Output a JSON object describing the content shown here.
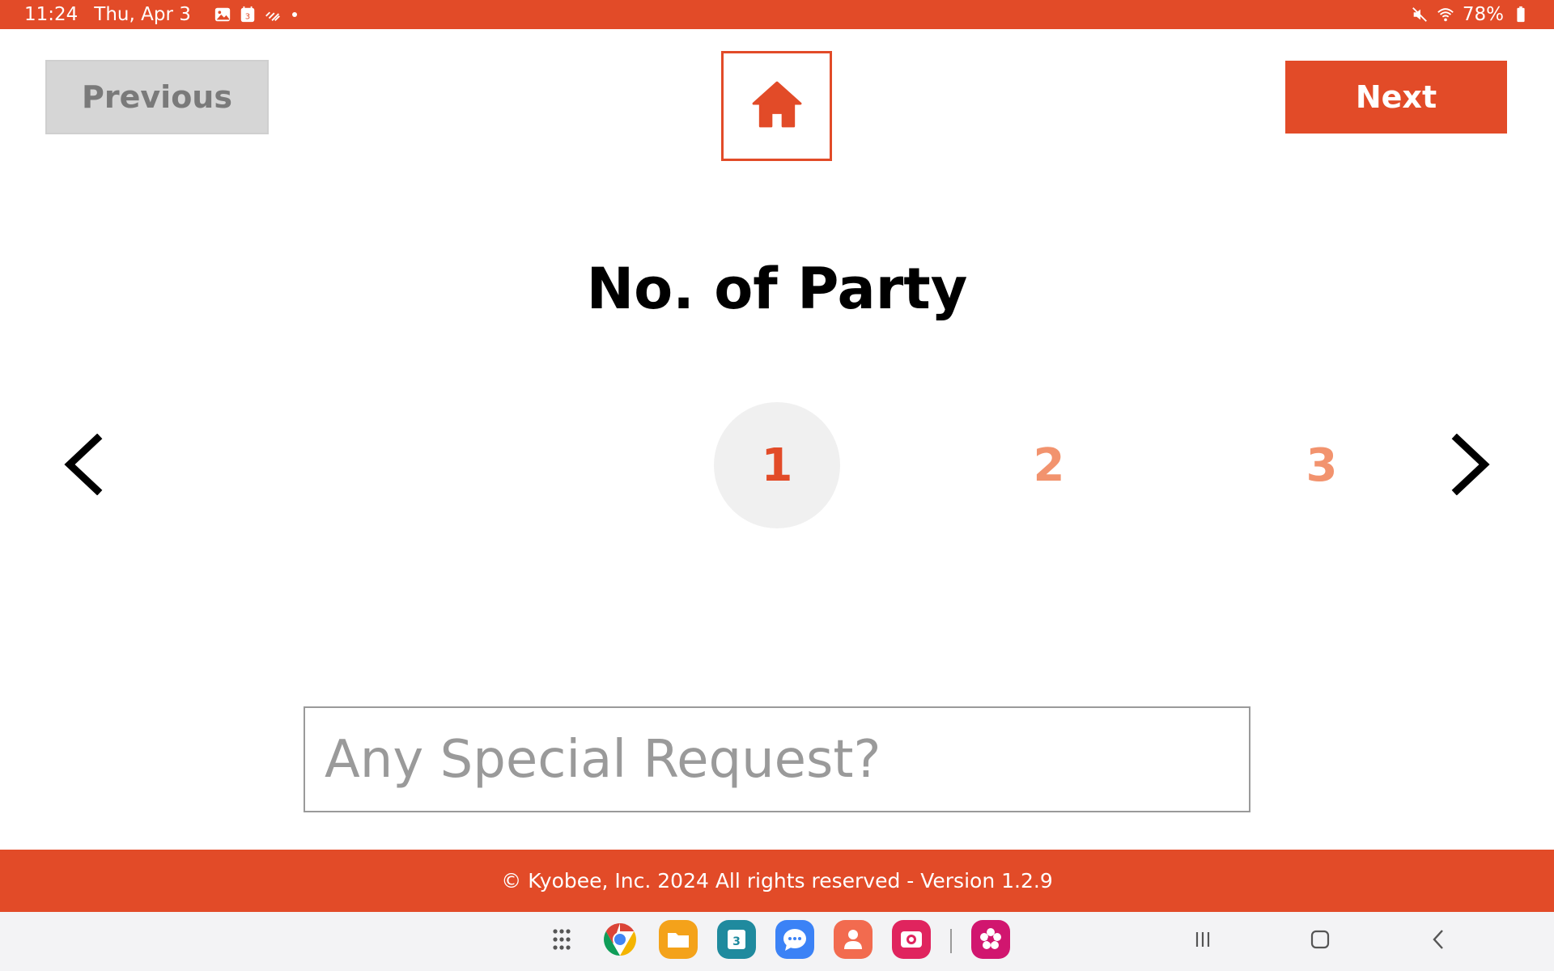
{
  "status_bar": {
    "time": "11:24",
    "date": "Thu, Apr 3",
    "notification_icons": [
      "gallery-icon",
      "calendar-icon",
      "tidal-icon"
    ],
    "battery": "78%",
    "right_icons": [
      "mute-icon",
      "wifi-icon",
      "battery-icon"
    ]
  },
  "header": {
    "previous_label": "Previous",
    "next_label": "Next",
    "home_icon": "home-icon"
  },
  "title": "No. of Party",
  "party_selector": {
    "options": [
      "1",
      "2",
      "3"
    ],
    "selected": "1"
  },
  "request": {
    "placeholder": "Any Special Request?",
    "value": ""
  },
  "footer": {
    "text": "© Kyobee, Inc. 2024 All rights reserved - Version 1.2.9"
  },
  "dock": {
    "apps": [
      "app-drawer",
      "chrome",
      "my-files",
      "calendar",
      "messages",
      "contacts",
      "screen-recorder",
      "blossom-app"
    ],
    "calendar_day": "3"
  },
  "colors": {
    "brand": "#e24b28",
    "selected_number": "#e24b28",
    "unselected_number": "#f2936e",
    "previous_bg": "#d6d6d6"
  }
}
